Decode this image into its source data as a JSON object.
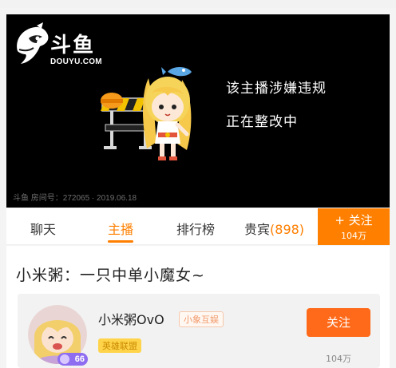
{
  "video": {
    "logo_text": "斗鱼",
    "logo_sub": "DOUYU.COM",
    "notice_line1": "该主播涉嫌违规",
    "notice_line2": "正在整改中",
    "footer": "斗鱼 房间号：272065 · 2019.06.18"
  },
  "tabs": {
    "items": [
      {
        "label": "聊天"
      },
      {
        "label": "主播"
      },
      {
        "label": "排行榜"
      },
      {
        "label": "贵宾"
      }
    ],
    "vip_count": "(898)",
    "active_index": 1
  },
  "follow_tab": {
    "label": "+ 关注",
    "count": "104万"
  },
  "room": {
    "title": "小米粥：一只中单小魔女~"
  },
  "streamer": {
    "name": "小米粥OvO",
    "guild": "小象互娱",
    "game": "英雄联盟",
    "level": "66",
    "follow_label": "关注",
    "follow_count": "104万"
  },
  "colors": {
    "accent": "#ff7f00",
    "follow_button": "#ff6a1a",
    "level_badge": "#8e6df0"
  }
}
